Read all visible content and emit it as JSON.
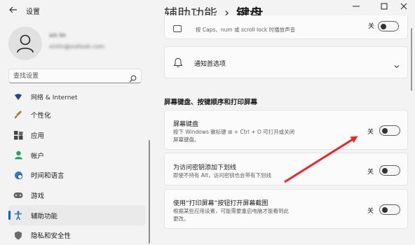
{
  "window": {
    "title": "设置",
    "min_icon": "minimize-icon",
    "max_icon": "maximize-icon",
    "close_icon": "close-icon"
  },
  "user": {
    "name": "xin lin",
    "email": "xinlin@outlook.com"
  },
  "search": {
    "placeholder": "查找设置"
  },
  "sidebar": {
    "items": [
      {
        "label": "网络 & Internet",
        "icon": "network-icon"
      },
      {
        "label": "个性化",
        "icon": "brush-icon"
      },
      {
        "label": "应用",
        "icon": "apps-icon"
      },
      {
        "label": "帐户",
        "icon": "account-icon"
      },
      {
        "label": "时间和语言",
        "icon": "globe-clock-icon"
      },
      {
        "label": "游戏",
        "icon": "gamepad-icon"
      },
      {
        "label": "辅助功能",
        "icon": "accessibility-icon",
        "active": true
      },
      {
        "label": "隐私和安全性",
        "icon": "shield-icon"
      }
    ]
  },
  "breadcrumb": {
    "parent": "辅助功能",
    "separator": "›",
    "current": "键盘"
  },
  "main": {
    "top_card": {
      "desc": "按 Caps、num 或 scroll lock 时播放声音",
      "state": "关"
    },
    "notify_card": {
      "title": "通知首选项"
    },
    "section_heading": "屏幕键盘、按键顺序和打印屏幕",
    "settings": [
      {
        "title": "屏幕键盘",
        "desc_line1": "按下 Windows 徽标键 ⊞ + Ctrl + O 可打开或关闭",
        "desc_line2": "屏幕键盘。",
        "state": "关",
        "on": false
      },
      {
        "title": "为访问密钥添加下划线",
        "desc_line1": "即使不持有 Alt，访问密钥也会带有下划线",
        "desc_line2": "",
        "state": "关",
        "on": false
      },
      {
        "title": "使用“打印屏幕”按钮打开屏幕截图",
        "desc_line1": "根据某些应用设置，可能需要重启电脑才能看到此",
        "desc_line2": "更改。",
        "state": "关",
        "on": false
      }
    ]
  },
  "colors": {
    "accent": "#005fb8",
    "annotation_arrow": "#e5262b",
    "background": "#f3f3f3",
    "card": "#fbfbfb"
  }
}
